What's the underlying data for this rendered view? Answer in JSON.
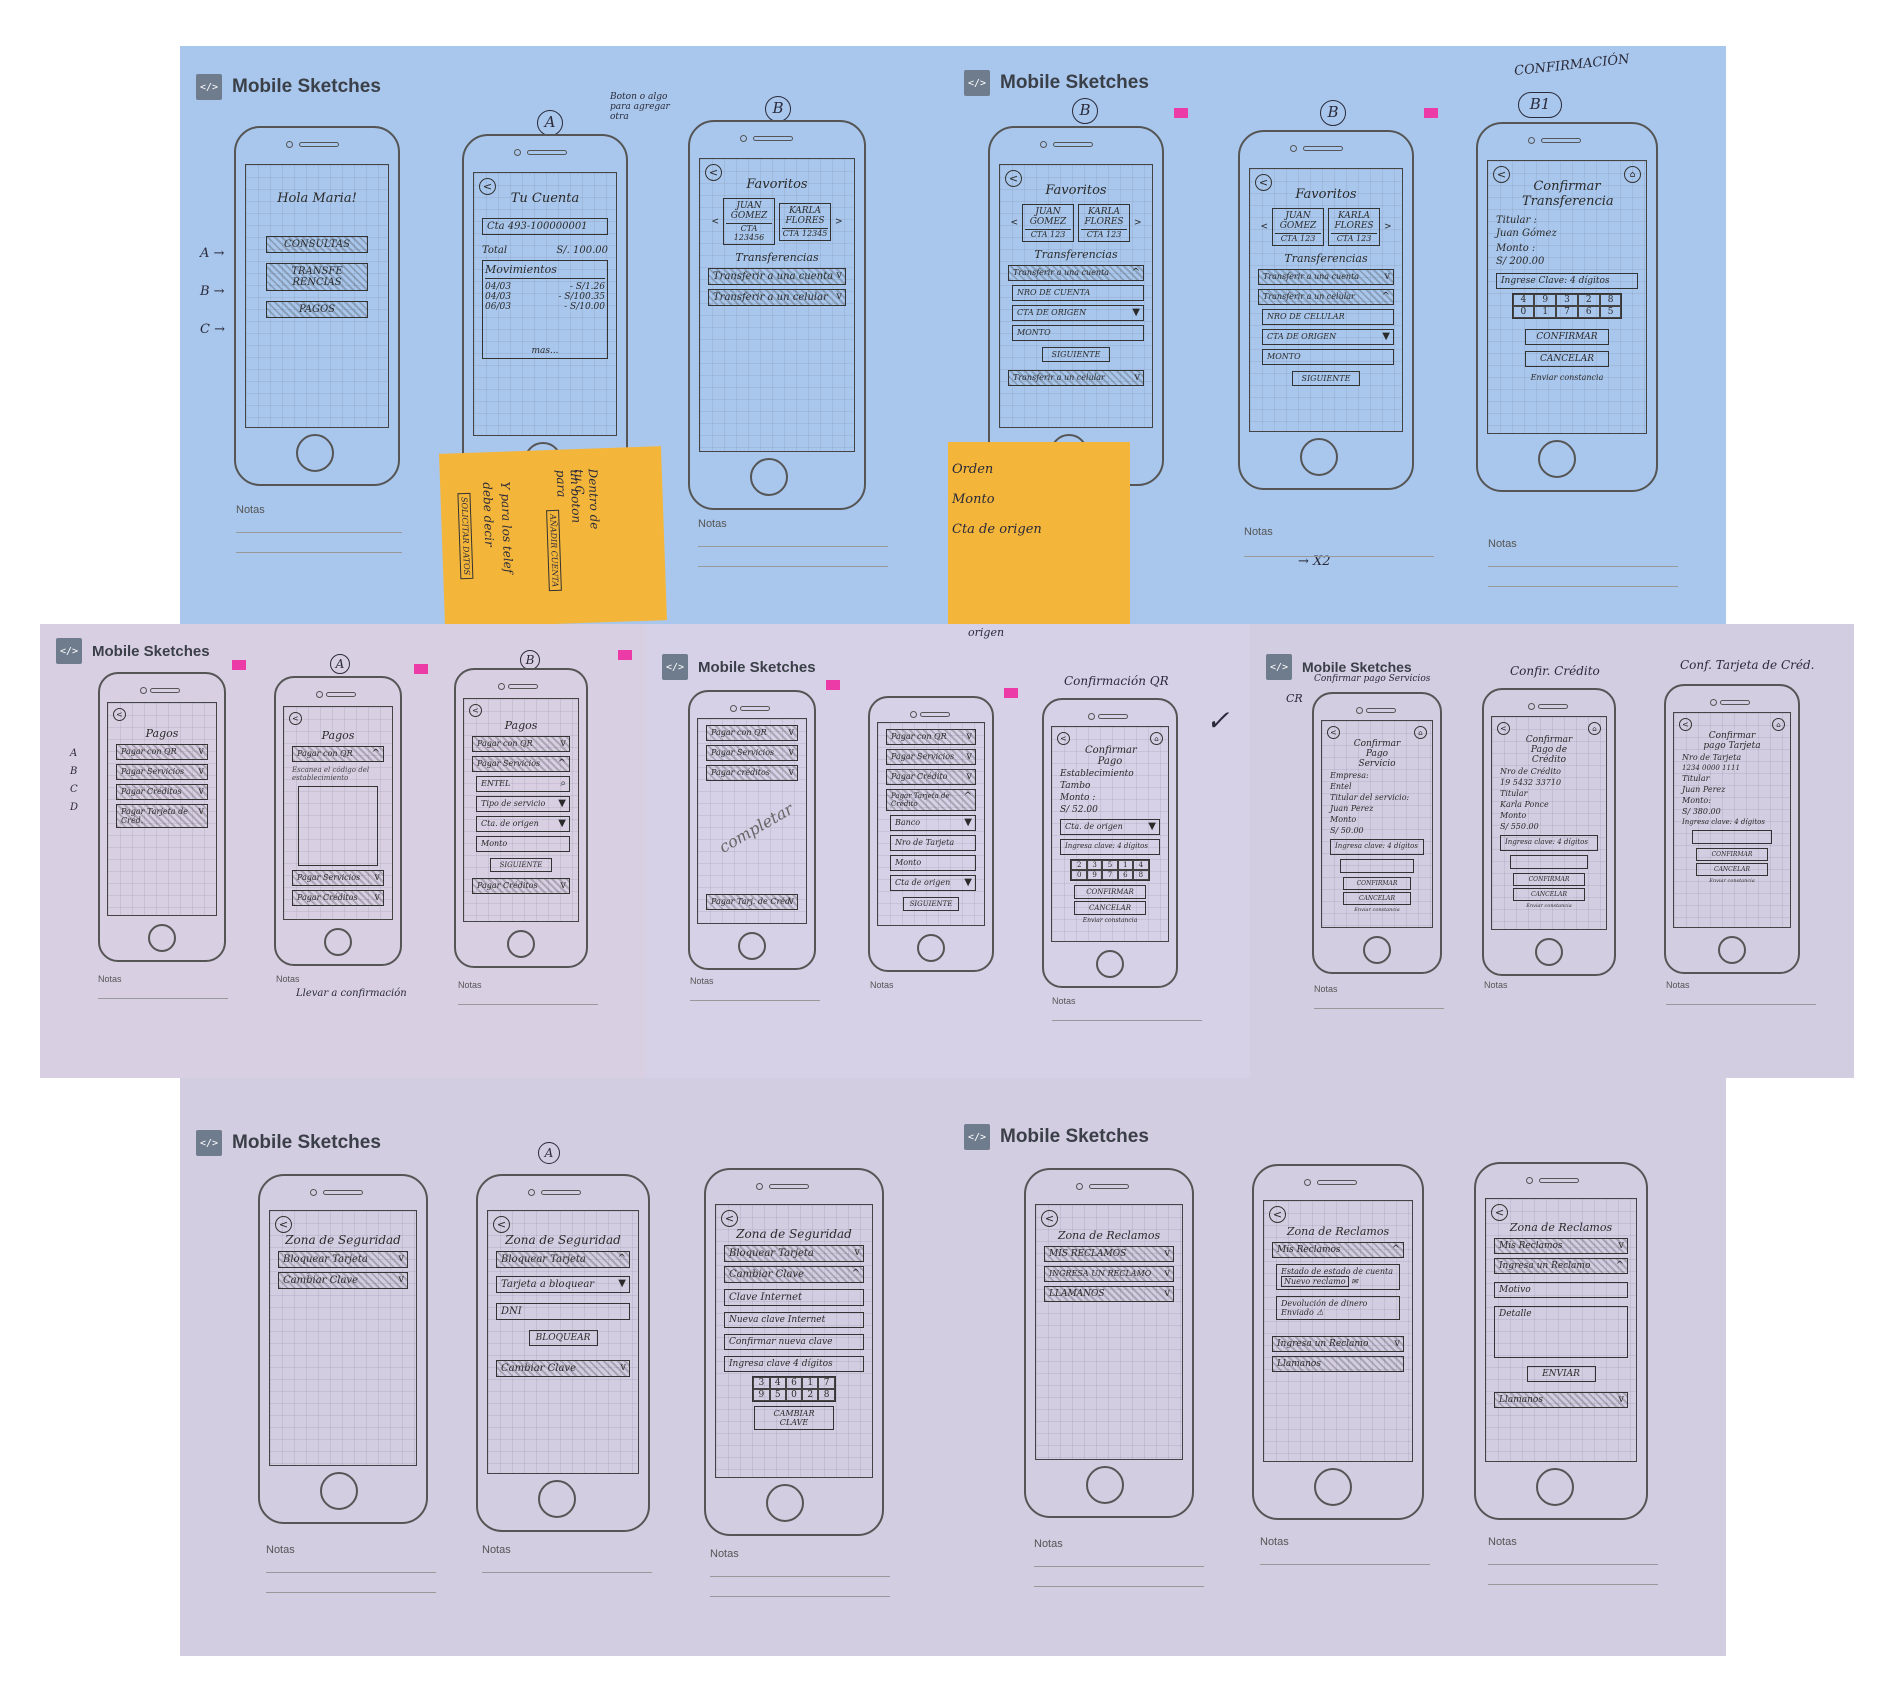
{
  "brand": "Mobile Sketches",
  "notes_label": "Notas",
  "sheet1": {
    "annotation_a": "A",
    "annotation_b": "B",
    "annotation_top": "Boton o algo para agregar otra",
    "margin_a": "A →",
    "margin_b": "B →",
    "margin_c": "C →",
    "p1": {
      "greeting": "Hola Maria!",
      "b1": "CONSULTAS",
      "b2": "TRANSFE RENCIAS",
      "b3": "PAGOS"
    },
    "p2": {
      "title": "Tu Cuenta",
      "cta": "Cta 493-100000001",
      "total_label": "Total",
      "total_value": "S/. 100.00",
      "mov_title": "Movimientos",
      "movs": [
        [
          "04/03",
          "- S/1.26"
        ],
        [
          "04/03",
          "- S/100.35"
        ],
        [
          "06/03",
          "- S/10.00"
        ]
      ],
      "more": "mas..."
    },
    "p3": {
      "title": "Favoritos",
      "f1": "JUAN GOMEZ",
      "f1c": "CTA 123456",
      "f2": "KARLA FLORES",
      "f2c": "CTA 12345",
      "sub": "Transferencias",
      "o1": "Transferir a una cuenta",
      "o2": "Transferir a un celular"
    },
    "sticky_lines": [
      "Dentro de tu C",
      "un boton para",
      "Y para los telef",
      "debe decir"
    ],
    "sticky_b1": "AÑADIR CUENTA",
    "sticky_b2": "SOLICITAR DATOS"
  },
  "sheet2": {
    "annotation": "CONFIRMACIÓN",
    "lab1": "B",
    "lab2": "B",
    "lab3": "B1",
    "p1": {
      "title": "Favoritos",
      "f1": "JUAN GOMEZ",
      "f1c": "CTA 123",
      "f2": "KARLA FLORES",
      "f2c": "CTA 123",
      "sub": "Transferencias",
      "o1": "Transferir a una cuenta",
      "f_a": "NRO DE CUENTA",
      "f_b": "CTA DE ORIGEN",
      "f_c": "MONTO",
      "btn": "SIGUIENTE",
      "o2": "Transferir a un celular"
    },
    "p2": {
      "title": "Favoritos",
      "f1": "JUAN GOMEZ",
      "f1c": "CTA 123",
      "f2": "KARLA FLORES",
      "f2c": "CTA 123",
      "sub": "Transferencias",
      "o1": "Transferir a una cuenta",
      "o2": "Transferir a un celular",
      "f_a": "NRO DE CELULAR",
      "f_b": "CTA DE ORIGEN",
      "f_c": "MONTO",
      "btn": "SIGUIENTE"
    },
    "p3": {
      "title": "Confirmar Transferencia",
      "titular_l": "Titular :",
      "titular": "Juan Gómez",
      "monto_l": "Monto :",
      "monto": "S/ 200.00",
      "clave": "Ingrese Clave: 4 dígitos",
      "keys": [
        "4",
        "9",
        "3",
        "2",
        "8",
        "0",
        "1",
        "7",
        "6",
        "5"
      ],
      "b1": "CONFIRMAR",
      "b2": "CANCELAR",
      "b3": "Enviar constancia"
    },
    "sticky_lines": [
      "Orden",
      "Monto",
      "Cta de origen"
    ],
    "x2": "X2"
  },
  "sheet3": {
    "lab_a": "A",
    "lab_b": "B",
    "side": [
      "A",
      "B",
      "C",
      "D"
    ],
    "p1": {
      "title": "Pagos",
      "items": [
        "Pagar con QR",
        "Pagar Servicios",
        "Pagar Créditos",
        "Pagar Tarjeta de Créd."
      ]
    },
    "p2": {
      "title": "Pagos",
      "qr": "Pagar con QR",
      "hint": "Escanea el código del establecimiento",
      "s": "Pagar Servicios",
      "c": "Pagar Créditos"
    },
    "p3": {
      "title": "Pagos",
      "qr": "Pagar con QR",
      "s": "Pagar Servicios",
      "ent": "ENTEL",
      "tipo": "Tipo de servicio",
      "cta": "Cta. de origen",
      "monto": "Monto",
      "btn": "SIGUIENTE",
      "c": "Pagar Créditos"
    },
    "note": "Llevar a confirmación"
  },
  "sheet4": {
    "annotation_top": "origen",
    "annotation": "Confirmación QR",
    "p1": {
      "items": [
        "Pagar con QR",
        "Pagar Servicios",
        "Pagar créditos"
      ],
      "watermark": "completar",
      "foot": "Pagar Tarj. de Créd."
    },
    "p2": {
      "items": [
        "Pagar con QR",
        "Pagar Servicios",
        "Pagar Crédito",
        "Pagar Tarjeta de Crédito"
      ],
      "f1": "Banco",
      "f2": "Nro de Tarjeta",
      "f3": "Monto",
      "f4": "Cta de origen",
      "btn": "SIGUIENTE"
    },
    "p3": {
      "title": "Confirmar Pago",
      "est_l": "Establecimiento",
      "est": "Tambo",
      "monto_l": "Monto :",
      "monto": "S/ 52.00",
      "cta": "Cta. de origen",
      "clave": "Ingresa clave: 4 dígitos",
      "keys": [
        "2",
        "3",
        "5",
        "1",
        "4",
        "0",
        "9",
        "7",
        "6",
        "8"
      ],
      "b1": "CONFIRMAR",
      "b2": "CANCELAR",
      "b3": "Enviar constancia"
    }
  },
  "sheet5": {
    "sub": "Confirmar pago Servicios",
    "ann1": "CR",
    "ann2": "Confir. Crédito",
    "ann3": "Conf. Tarjeta de Créd.",
    "p1": {
      "title": "Confirmar Pago Servicio",
      "l1": "Empresa:",
      "v1": "Entel",
      "l2": "Titular del servicio:",
      "v2": "Juan Perez",
      "l3": "Monto",
      "v3": "S/ 50.00",
      "clave": "Ingresa clave: 4 dígitos",
      "b1": "CONFIRMAR",
      "b2": "CANCELAR",
      "b3": "Enviar constancia"
    },
    "p2": {
      "title": "Confirmar Pago de Crédito",
      "l1": "Nro de Crédito",
      "v1": "19 5432 33710",
      "l2": "Titular",
      "v2": "Karla Ponce",
      "l3": "Monto",
      "v3": "S/ 550.00",
      "clave": "Ingresa clave: 4 dígitos",
      "b1": "CONFIRMAR",
      "b2": "CANCELAR",
      "b3": "Enviar constancia"
    },
    "p3": {
      "title": "Confirmar pago Tarjeta",
      "l1": "Nro de Tarjeta",
      "v1": "1234 0000 1111",
      "l2": "Titular",
      "v2": "Juan Perez",
      "l3": "Monto:",
      "v3": "S/ 380.00",
      "clave": "Ingresa clave: 4 dígitos",
      "b1": "CONFIRMAR",
      "b2": "CANCELAR",
      "b3": "Enviar constancia"
    }
  },
  "sheet6": {
    "lab_a": "A",
    "p1": {
      "title": "Zona de Seguridad",
      "o1": "Bloquear Tarjeta",
      "o2": "Cambiar Clave"
    },
    "p2": {
      "title": "Zona de Seguridad",
      "o1": "Bloquear Tarjeta",
      "f1": "Tarjeta a bloquear",
      "f2": "DNI",
      "btn": "BLOQUEAR",
      "o2": "Cambiar Clave"
    },
    "p3": {
      "title": "Zona de Seguridad",
      "o1": "Bloquear Tarjeta",
      "o2": "Cambiar Clave",
      "f1": "Clave Internet",
      "f2": "Nueva clave Internet",
      "f3": "Confirmar nueva clave",
      "f4": "Ingresa clave 4 dígitos",
      "keys": [
        "3",
        "4",
        "6",
        "1",
        "7",
        "9",
        "5",
        "0",
        "2",
        "8"
      ],
      "btn": "CAMBIAR CLAVE"
    }
  },
  "sheet7": {
    "p1": {
      "title": "Zona de Reclamos",
      "items": [
        "MIS RECLAMOS",
        "INGRESA UN RECLAMO",
        "LLAMANOS"
      ]
    },
    "p2": {
      "title": "Zona de Reclamos",
      "h": "Mis Reclamos",
      "c1": "Estado de estado de cuenta",
      "c1s": "Nuevo reclamo",
      "c2": "Devolución de dinero",
      "c2s": "Enviado",
      "i": "Ingresa un Reclamo",
      "l": "Llamanos"
    },
    "p3": {
      "title": "Zona de Reclamos",
      "h": "Mis Reclamos",
      "i": "Ingresa un Reclamo",
      "f1": "Motivo",
      "f2": "Detalle",
      "btn": "ENVIAR",
      "l": "Llamanos"
    }
  }
}
